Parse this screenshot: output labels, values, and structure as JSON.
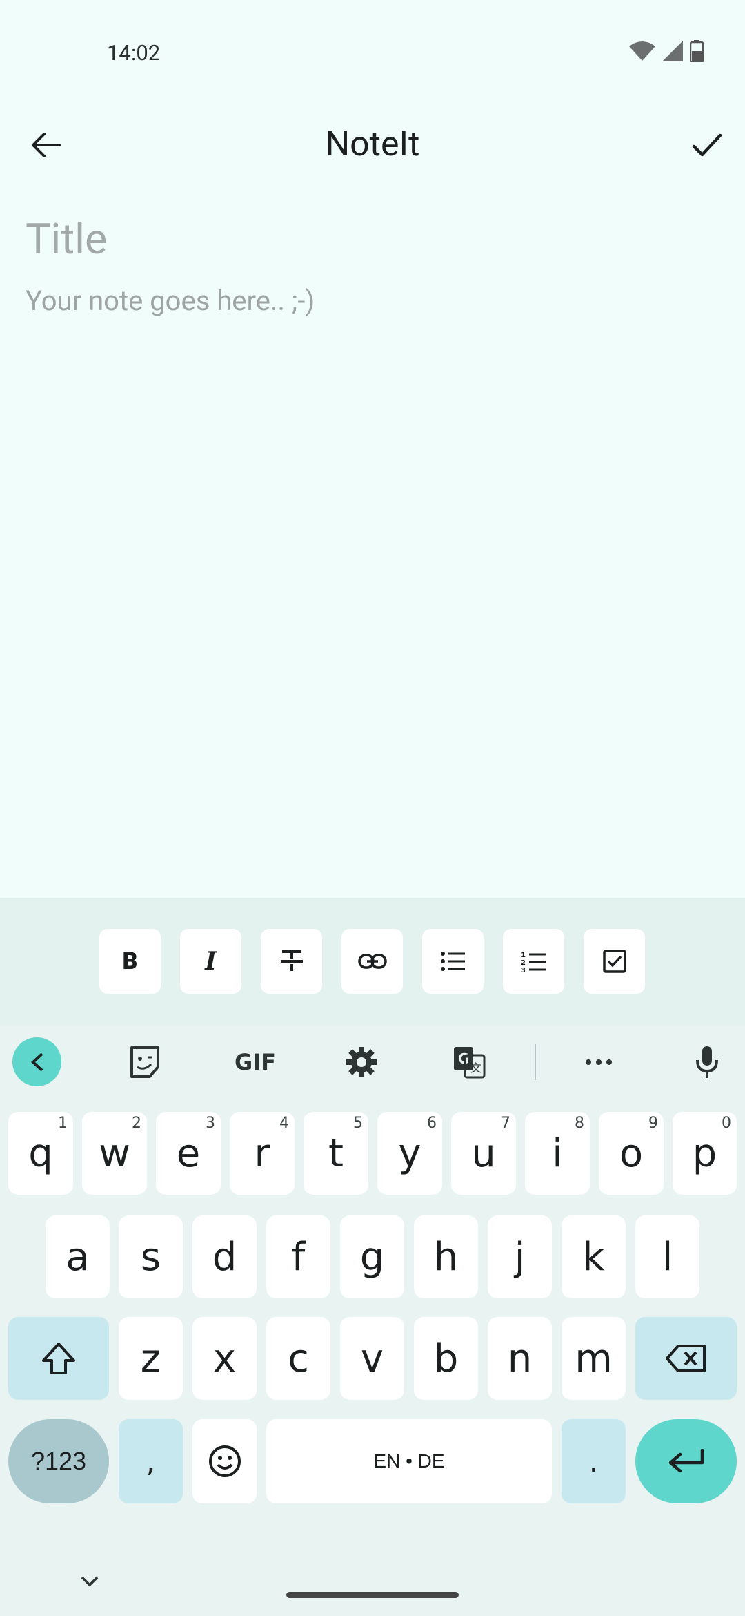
{
  "status_bar": {
    "time": "14:02"
  },
  "app_bar": {
    "title": "NoteIt"
  },
  "editor": {
    "title_placeholder": "Title",
    "body_placeholder": "Your note goes here.. ;-)"
  },
  "format_toolbar": {
    "items": [
      "bold",
      "italic",
      "strikethrough",
      "link",
      "bulleted-list",
      "numbered-list",
      "checklist"
    ]
  },
  "keyboard": {
    "suggestion_bar": {
      "gif_label": "GIF",
      "items": [
        "back-arrow",
        "sticker",
        "gif",
        "settings",
        "translate",
        "more",
        "microphone"
      ]
    },
    "row1": [
      {
        "key": "q",
        "hint": "1"
      },
      {
        "key": "w",
        "hint": "2"
      },
      {
        "key": "e",
        "hint": "3"
      },
      {
        "key": "r",
        "hint": "4"
      },
      {
        "key": "t",
        "hint": "5"
      },
      {
        "key": "y",
        "hint": "6"
      },
      {
        "key": "u",
        "hint": "7"
      },
      {
        "key": "i",
        "hint": "8"
      },
      {
        "key": "o",
        "hint": "9"
      },
      {
        "key": "p",
        "hint": "0"
      }
    ],
    "row2": [
      "a",
      "s",
      "d",
      "f",
      "g",
      "h",
      "j",
      "k",
      "l"
    ],
    "row3": [
      "z",
      "x",
      "c",
      "v",
      "b",
      "n",
      "m"
    ],
    "symbols_key": "?123",
    "comma_key": ",",
    "space_label": "EN • DE",
    "period_key": "."
  },
  "colors": {
    "background": "#f1fdfb",
    "toolbar_background": "#e3f1ef",
    "keyboard_background": "#e8f3f2",
    "accent": "#5fd6cb",
    "special_key": "#c8e8ef",
    "symbols_key": "#a8c8cd"
  }
}
